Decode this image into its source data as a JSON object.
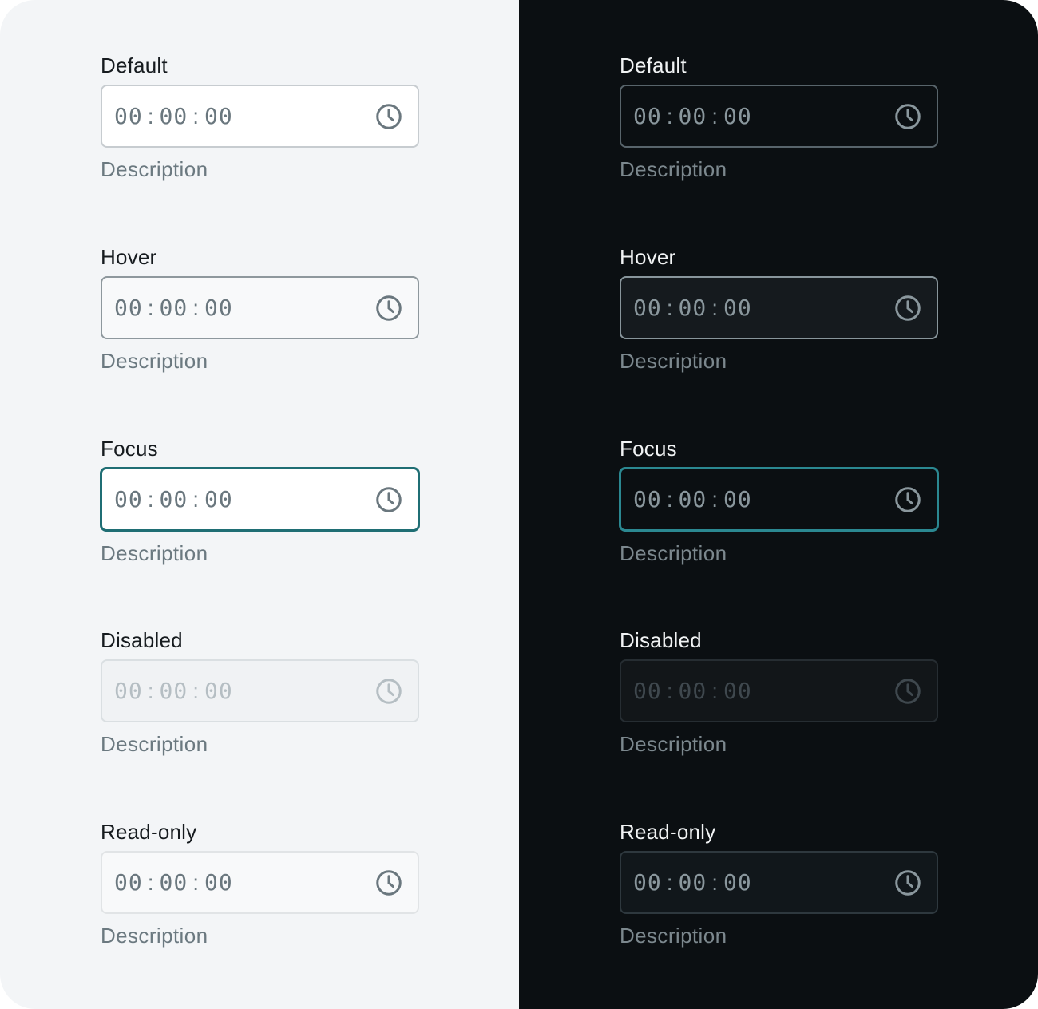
{
  "light": {
    "fields": [
      {
        "label": "Default",
        "hours": "00",
        "minutes": "00",
        "seconds": "00",
        "description": "Description"
      },
      {
        "label": "Hover",
        "hours": "00",
        "minutes": "00",
        "seconds": "00",
        "description": "Description"
      },
      {
        "label": "Focus",
        "hours": "00",
        "minutes": "00",
        "seconds": "00",
        "description": "Description"
      },
      {
        "label": "Disabled",
        "hours": "00",
        "minutes": "00",
        "seconds": "00",
        "description": "Description"
      },
      {
        "label": "Read-only",
        "hours": "00",
        "minutes": "00",
        "seconds": "00",
        "description": "Description"
      }
    ]
  },
  "dark": {
    "fields": [
      {
        "label": "Default",
        "hours": "00",
        "minutes": "00",
        "seconds": "00",
        "description": "Description"
      },
      {
        "label": "Hover",
        "hours": "00",
        "minutes": "00",
        "seconds": "00",
        "description": "Description"
      },
      {
        "label": "Focus",
        "hours": "00",
        "minutes": "00",
        "seconds": "00",
        "description": "Description"
      },
      {
        "label": "Disabled",
        "hours": "00",
        "minutes": "00",
        "seconds": "00",
        "description": "Description"
      },
      {
        "label": "Read-only",
        "hours": "00",
        "minutes": "00",
        "seconds": "00",
        "description": "Description"
      }
    ]
  },
  "separator": ":",
  "icons": {
    "clock": "clock-icon"
  },
  "colors": {
    "light_background": "#f3f5f7",
    "dark_background": "#0b0f12",
    "focus_accent_light": "#1f6e74",
    "focus_accent_dark": "#2b8891"
  }
}
